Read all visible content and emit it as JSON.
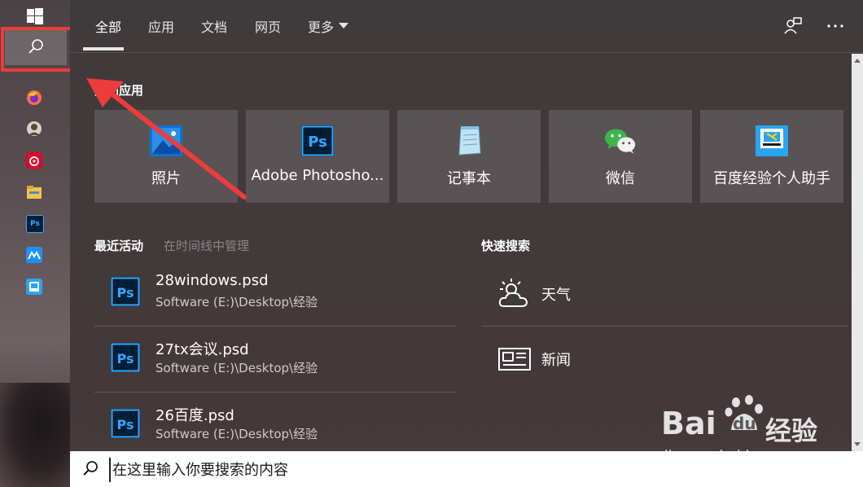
{
  "taskbar": {
    "icons": [
      {
        "name": "windows-start-icon"
      },
      {
        "name": "search-icon"
      },
      {
        "name": "firefox-icon",
        "color": "#ff7139"
      },
      {
        "name": "avatar-app-icon",
        "color": "#9a8a7a"
      },
      {
        "name": "netease-music-icon",
        "color": "#e60026"
      },
      {
        "name": "file-explorer-icon",
        "color": "#f5c542"
      },
      {
        "name": "photoshop-icon",
        "color": "#31a8ff",
        "text": "Ps"
      },
      {
        "name": "app-blue-icon",
        "color": "#1e90ff"
      },
      {
        "name": "baidu-helper-icon",
        "color": "#2aa4f4"
      }
    ]
  },
  "tabs": [
    {
      "label": "全部",
      "active": true
    },
    {
      "label": "应用"
    },
    {
      "label": "文档"
    },
    {
      "label": "网页"
    },
    {
      "label": "更多"
    }
  ],
  "hot_apps": {
    "title": "热门应用",
    "items": [
      {
        "label": "照片",
        "icon": "photos-icon"
      },
      {
        "label": "Adobe Photosho...",
        "icon": "photoshop-icon"
      },
      {
        "label": "记事本",
        "icon": "notepad-icon"
      },
      {
        "label": "微信",
        "icon": "wechat-icon"
      },
      {
        "label": "百度经验个人助手",
        "icon": "baidu-helper-icon"
      }
    ]
  },
  "recent": {
    "title": "最近活动",
    "manage": "在时间线中管理",
    "items": [
      {
        "name": "28windows.psd",
        "path": "Software (E:)\\Desktop\\经验"
      },
      {
        "name": "27tx会议.psd",
        "path": "Software (E:)\\Desktop\\经验"
      },
      {
        "name": "26百度.psd",
        "path": "Software (E:)\\Desktop\\经验"
      }
    ]
  },
  "quick_search": {
    "title": "快速搜索",
    "items": [
      {
        "label": "天气",
        "icon": "weather-icon"
      },
      {
        "label": "新闻",
        "icon": "news-icon"
      }
    ]
  },
  "searchbox": {
    "placeholder": "在这里输入你要搜索的内容"
  },
  "watermark": {
    "brand": "Bai",
    "du": "du",
    "cn": "经验",
    "url": "jingyan.baidu.com"
  },
  "colors": {
    "annotation": "#ee3b3b",
    "ps_blue": "#31a8ff",
    "ps_dark": "#001e36"
  }
}
